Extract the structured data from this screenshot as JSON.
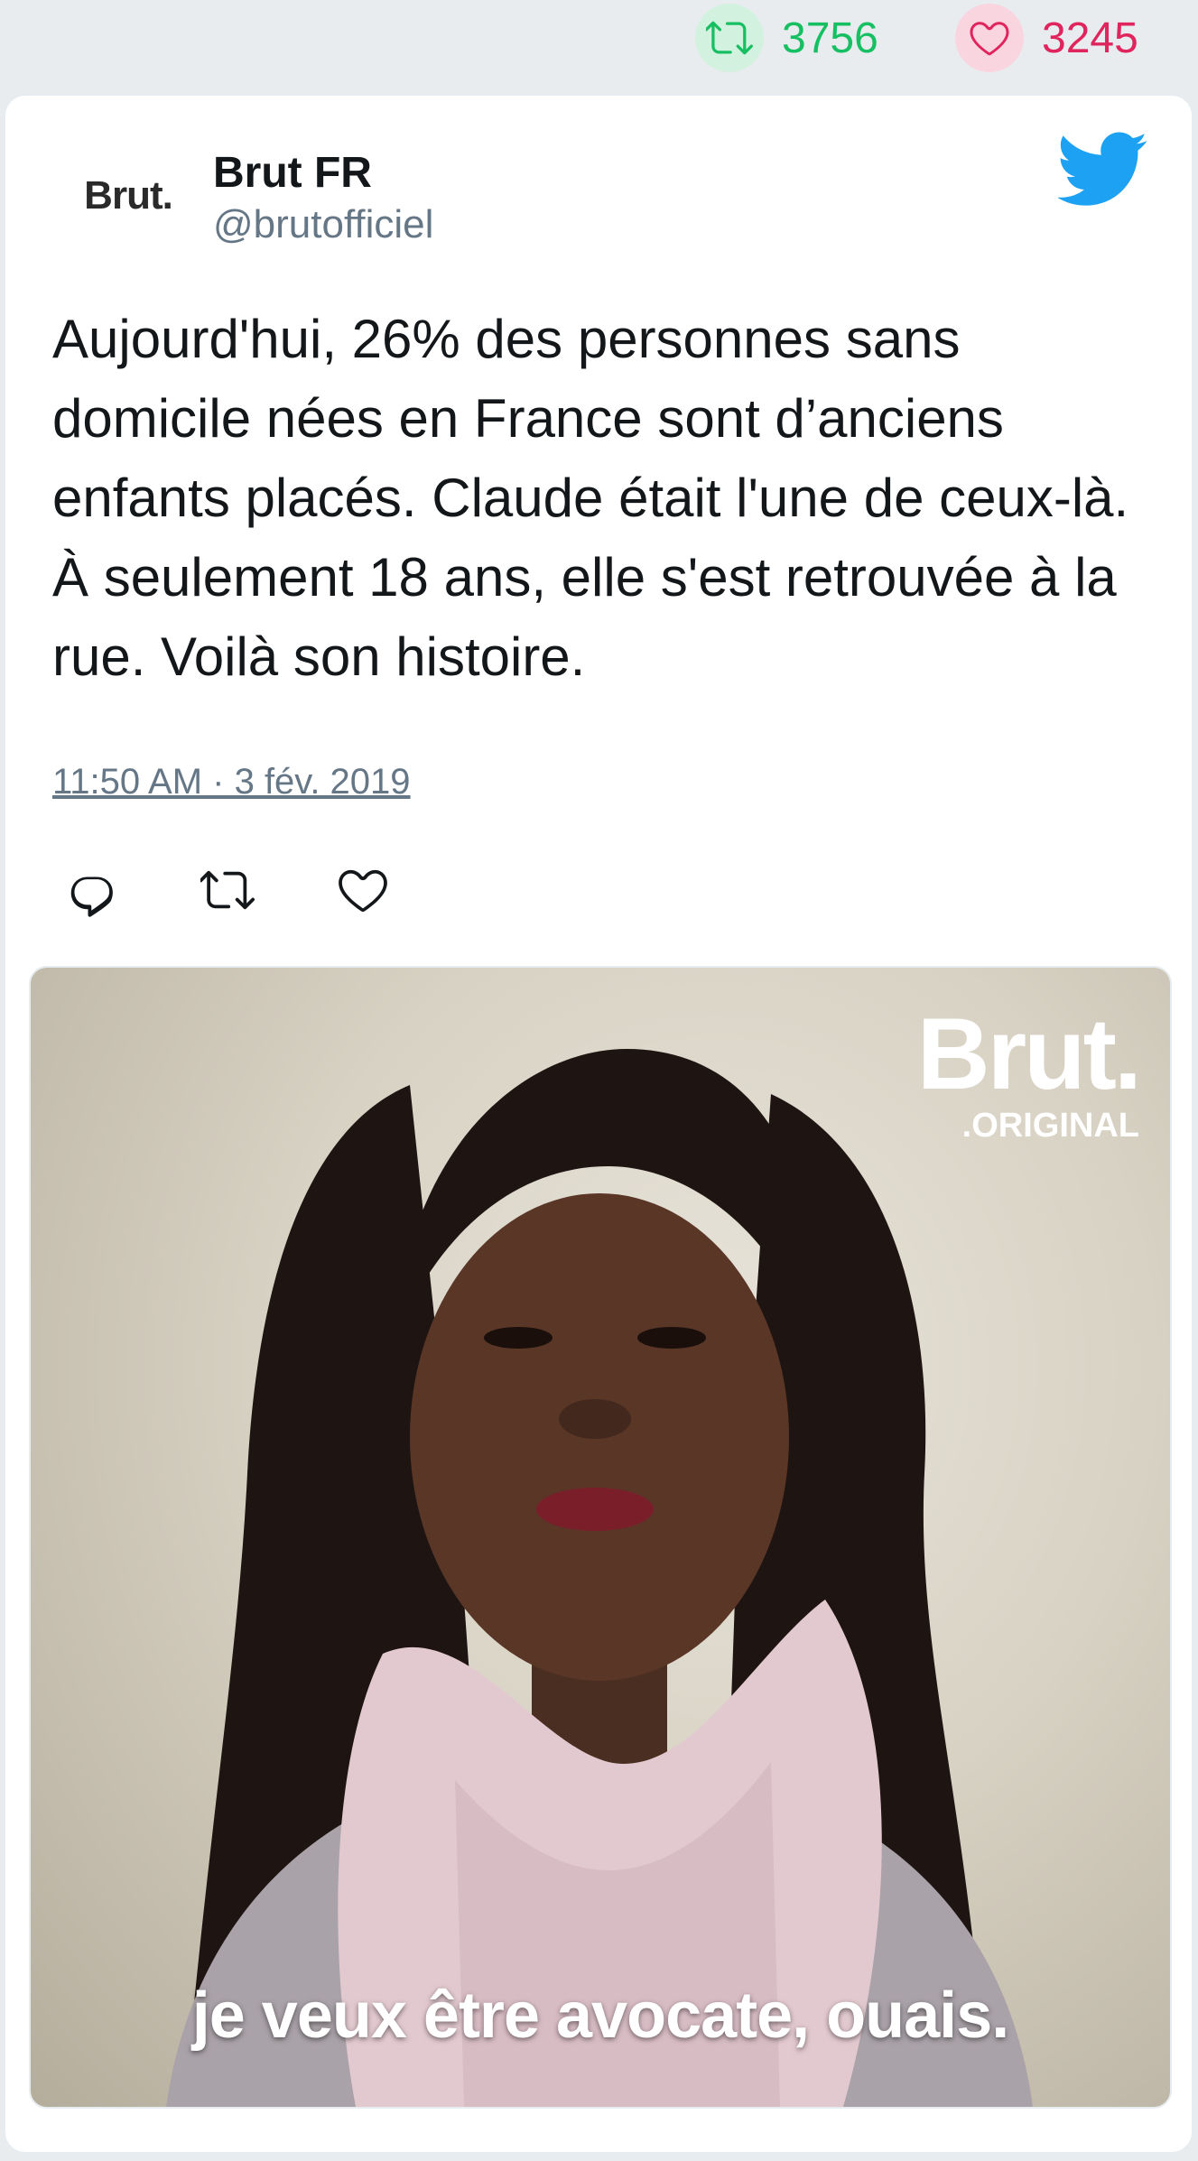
{
  "stats": {
    "retweets": "3756",
    "likes": "3245",
    "retweet_color": "#17bf63",
    "like_color": "#e0245e"
  },
  "tweet": {
    "avatar_text": "Brut.",
    "author_name": "Brut FR",
    "author_handle": "@brutofficiel",
    "text": "Aujourd'hui, 26% des personnes sans domicile nées en France sont d’anciens enfants placés. Claude était l'une de ceux-là. À seulement 18 ans, elle s'est retrouvée à la rue. Voilà son histoire.",
    "timestamp": "11:50 AM · 3 fév. 2019",
    "brand_color": "#1da1f2"
  },
  "icons": [
    "retweet-icon",
    "heart-icon",
    "twitter-bird-icon",
    "reply-icon"
  ],
  "media": {
    "logo_main": "Brut.",
    "logo_sub": ".ORIGINAL",
    "caption": "je veux être avocate, ouais."
  }
}
